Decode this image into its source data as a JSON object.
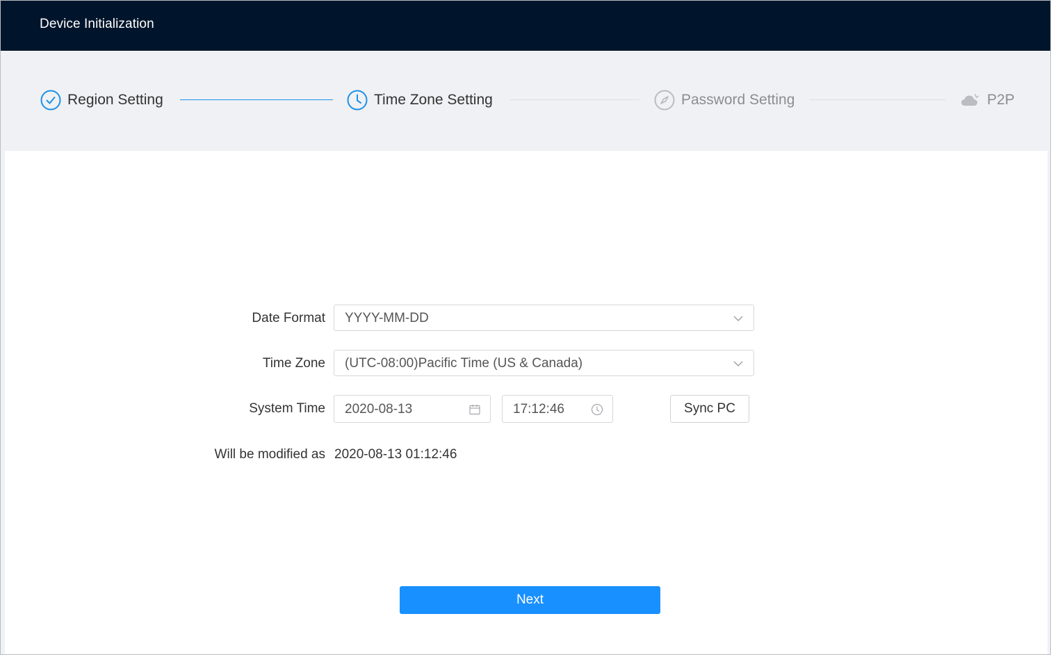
{
  "app": {
    "title": "Device Initialization"
  },
  "steps": [
    {
      "label": "Region Setting",
      "icon": "check-circle-icon",
      "state": "done"
    },
    {
      "label": "Time Zone Setting",
      "icon": "clock-icon",
      "state": "current"
    },
    {
      "label": "Password Setting",
      "icon": "compass-icon",
      "state": "pending"
    },
    {
      "label": "P2P",
      "icon": "cloud-icon",
      "state": "pending"
    }
  ],
  "form": {
    "date_format": {
      "label": "Date Format",
      "value": "YYYY-MM-DD",
      "icon": "chevron-down-icon"
    },
    "time_zone": {
      "label": "Time Zone",
      "value": "(UTC-08:00)Pacific Time (US & Canada)",
      "icon": "chevron-down-icon"
    },
    "system_time": {
      "label": "System Time",
      "date": "2020-08-13",
      "date_icon": "calendar-icon",
      "time": "17:12:46",
      "time_icon": "clock-icon",
      "sync_label": "Sync PC"
    },
    "modified": {
      "label": "Will be modified as",
      "value": "2020-08-13 01:12:46"
    }
  },
  "actions": {
    "next_label": "Next"
  },
  "colors": {
    "header_bg": "#00152b",
    "accent": "#1890ff",
    "step_active": "#1c90e8",
    "step_inactive": "#b9bcc1",
    "page_bg": "#f0f1f4"
  }
}
